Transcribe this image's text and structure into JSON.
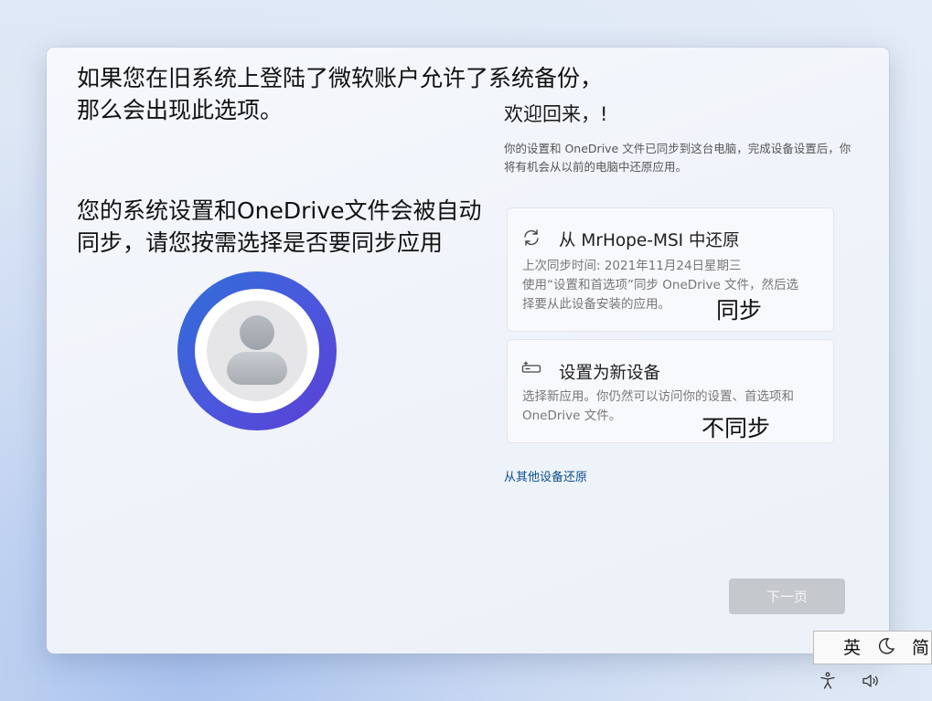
{
  "annotations": {
    "top_note_line1": "如果您在旧系统上登陆了微软账户允许了系统备份，",
    "top_note_line2": "那么会出现此选项。",
    "mid_note_line1": "您的系统设置和OneDrive文件会被自动",
    "mid_note_line2": "同步，请您按需选择是否要同步应用",
    "sync_note": "同步",
    "nosync_note": "不同步"
  },
  "header": {
    "title": "欢迎回来，!",
    "description": "你的设置和 OneDrive 文件已同步到这台电脑，完成设备设置后，你将有机会从以前的电脑中还原应用。"
  },
  "options": [
    {
      "icon": "sync-icon",
      "title": "从 MrHope-MSI 中还原",
      "line1": "上次同步时间: 2021年11月24日星期三",
      "line2": "使用“设置和首选项”同步 OneDrive 文件，然后选择要从此设备安装的应用。"
    },
    {
      "icon": "new-device-icon",
      "title": "设置为新设备",
      "line1": "选择新应用。你仍然可以访问你的设置、首选项和 OneDrive 文件。"
    }
  ],
  "restore_link": "从其他设备还原",
  "next_button": "下一页",
  "ime": {
    "lang": "英",
    "mode_icon": "moon-icon",
    "script": "简"
  },
  "tray": {
    "accessibility_icon": "accessibility-icon",
    "volume_icon": "volume-icon"
  }
}
